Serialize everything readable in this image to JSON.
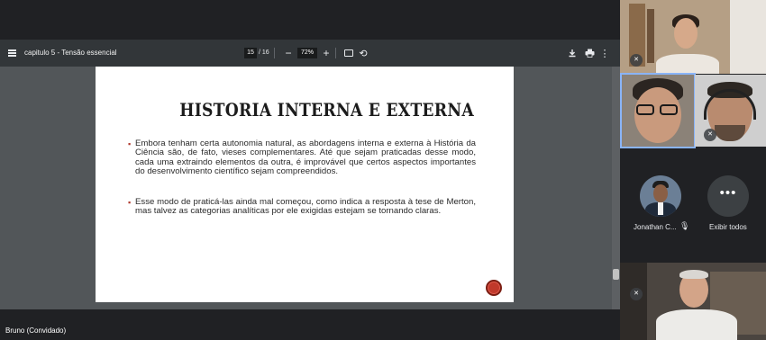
{
  "viewer": {
    "doc_title": "capitulo 5 - Tensão essencial",
    "current_page": "15",
    "total_pages": "/ 16",
    "zoom": "72%",
    "icons": [
      "menu-icon",
      "zoom-out-icon",
      "zoom-in-icon",
      "fit-page-icon",
      "rotate-icon",
      "download-icon",
      "print-icon",
      "more-vert-icon"
    ]
  },
  "slide": {
    "title": "HISTORIA INTERNA E EXTERNA",
    "bullet_1": "Embora tenham certa autonomia natural, as abordagens interna e externa à História da Ciência são, de fato, vieses complementares. Até que sejam praticadas desse modo, cada uma extraindo elementos da outra, é improvável que certos aspectos importantes do desenvolvimento científico sejam compreendidos.",
    "bullet_2": "Esse modo de praticá-las ainda mal começou, como indica a resposta à tese de Merton, mas talvez as categorias analíticas por ele exigidas estejam se tornando claras.",
    "bullet_mark": "▪",
    "accent_color": "#b03a2e"
  },
  "meeting": {
    "participant_name": "Jonathan C...",
    "more_label": "Exibir todos",
    "more_glyph": "•••",
    "presenter_label": "Bruno (Convidado)",
    "highlight_color": "#8ab4f8"
  }
}
